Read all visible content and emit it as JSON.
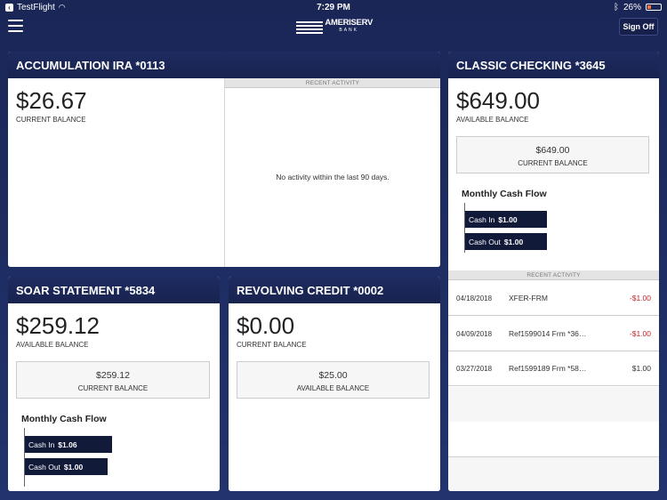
{
  "status_bar": {
    "app_back": "TestFlight",
    "time": "7:29 PM",
    "battery": "26%"
  },
  "header": {
    "logo_name": "AMERISERV",
    "logo_sub": "BANK",
    "sign_off": "Sign Off"
  },
  "accounts": {
    "ira": {
      "title": "ACCUMULATION IRA *0113",
      "amount": "$26.67",
      "amount_label": "CURRENT BALANCE",
      "recent_activity_label": "RECENT ACTIVITY",
      "no_activity": "No activity within the last 90 days."
    },
    "checking": {
      "title": "CLASSIC CHECKING *3645",
      "amount": "$649.00",
      "amount_label": "AVAILABLE BALANCE",
      "box_value": "$649.00",
      "box_label": "CURRENT BALANCE",
      "cash_flow_title": "Monthly Cash Flow",
      "cash_in_label": "Cash In",
      "cash_in_value": "$1.00",
      "cash_out_label": "Cash Out",
      "cash_out_value": "$1.00",
      "recent_activity_label": "RECENT ACTIVITY",
      "activity": [
        {
          "date": "04/18/2018",
          "desc": "XFER-FRM",
          "amount": "-$1.00",
          "negative": true
        },
        {
          "date": "04/09/2018",
          "desc": "Ref1599014 Frm *36…",
          "amount": "-$1.00",
          "negative": true
        },
        {
          "date": "03/27/2018",
          "desc": "Ref1599189 Frm *58…",
          "amount": "$1.00",
          "negative": false
        }
      ]
    },
    "soar": {
      "title": "SOAR STATEMENT *5834",
      "amount": "$259.12",
      "amount_label": "AVAILABLE BALANCE",
      "box_value": "$259.12",
      "box_label": "CURRENT BALANCE",
      "cash_flow_title": "Monthly Cash Flow",
      "cash_in_label": "Cash In",
      "cash_in_value": "$1.06",
      "cash_out_label": "Cash Out",
      "cash_out_value": "$1.00"
    },
    "revolving": {
      "title": "REVOLVING CREDIT *0002",
      "amount": "$0.00",
      "amount_label": "CURRENT BALANCE",
      "box_value": "$25.00",
      "box_label": "AVAILABLE BALANCE"
    }
  },
  "colors": {
    "background": "#1c2a5e",
    "header": "#18234f",
    "negative": "#c2262d",
    "bar": "#121a3a"
  }
}
